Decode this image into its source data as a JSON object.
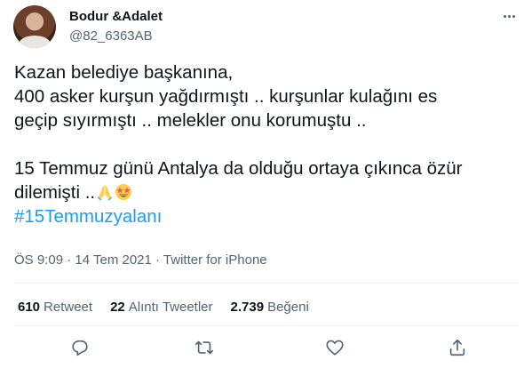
{
  "user": {
    "display_name": "Bodur &Adalet",
    "handle": "@82_6363AB"
  },
  "tweet": {
    "line1": "Kazan belediye başkanına,",
    "line2": "400 asker kurşun yağdırmıştı .. kurşunlar kulağını es",
    "line3": "geçip sıyırmıştı .. melekler onu korumuştu ..",
    "line4": "15 Temmuz günü Antalya da olduğu ortaya çıkınca özür",
    "line5": "dilemişti ..",
    "hashtag": "#15Temmuzyalanı"
  },
  "meta": {
    "time": "ÖS 9:09",
    "separator1": " · ",
    "date": "14 Tem 2021",
    "separator2": " · ",
    "source": "Twitter for iPhone"
  },
  "stats": {
    "retweets_count": "610",
    "retweets_label": "Retweet",
    "quotes_count": "22",
    "quotes_label": "Alıntı Tweetler",
    "likes_count": "2.739",
    "likes_label": "Beğeni"
  },
  "icons": {
    "more": "more-dots-icon",
    "reply": "reply-bubble-icon",
    "retweet": "retweet-arrows-icon",
    "like": "heart-icon",
    "share": "share-upload-icon",
    "emoji1": "folded-hands-emoji",
    "emoji2": "star-struck-emoji"
  },
  "colors": {
    "hashtag": "#1d9bf0",
    "secondary_text": "#536471",
    "divider": "#eff3f4"
  }
}
